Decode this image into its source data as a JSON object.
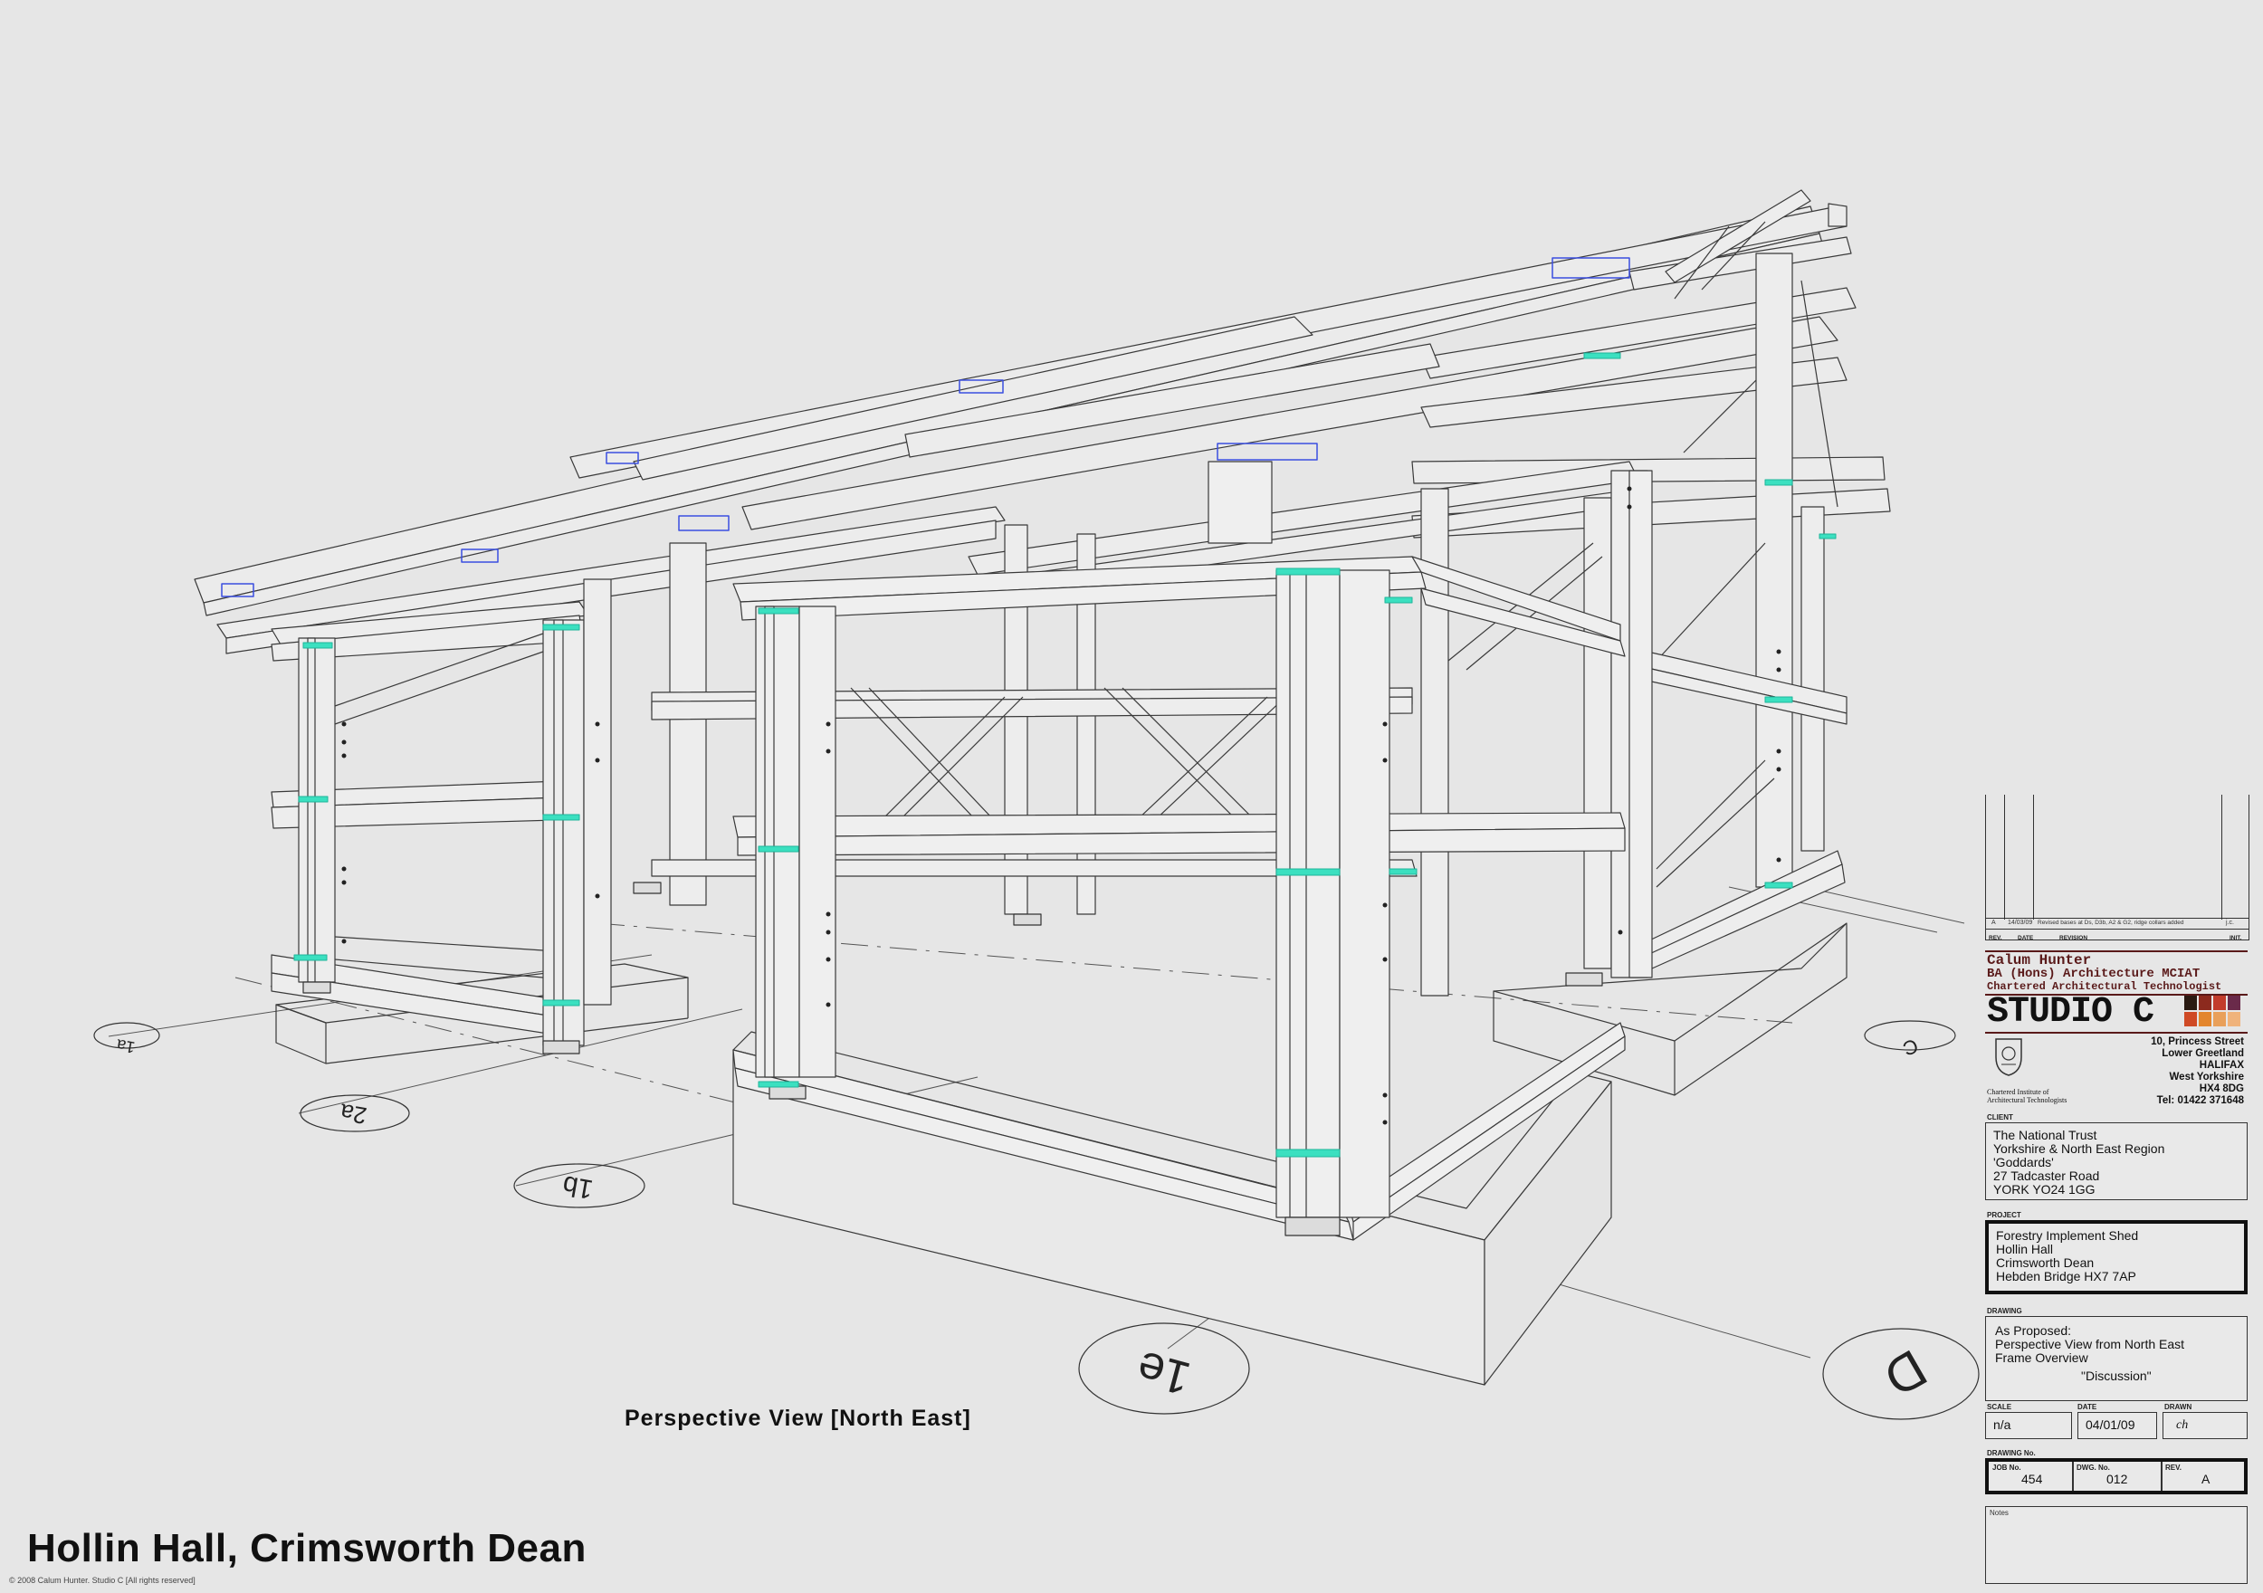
{
  "sheet": {
    "main_title": "Hollin Hall, Crimsworth Dean",
    "copyright": "©  2008 Calum Hunter.  Studio C  [All rights reserved]",
    "view_title": "Perspective View [North East]"
  },
  "grid_labels": [
    "1a",
    "2a",
    "1b",
    "1e",
    "C",
    "D"
  ],
  "revisions": {
    "row": {
      "rev": "A",
      "date": "14/03/09",
      "description": "Revised bases at Ds, D3b, A2 & G2, ridge collars added",
      "init": "j.c."
    },
    "headers": [
      "REV.",
      "DATE",
      "REVISION",
      "INIT."
    ]
  },
  "firm": {
    "name_lines": [
      "Calum Hunter",
      "BA (Hons) Architecture MCIAT",
      "Chartered Architectural Technologist"
    ],
    "studio": "STUDIO C",
    "swatch_colors": [
      "#2a1a12",
      "#8c2a1e",
      "#c23c2c",
      "#6a2a4a",
      "#cf4a25",
      "#e3862d",
      "#e9a05a",
      "#f0b37b"
    ],
    "address_lines": [
      "10, Princess Street",
      "Lower Greetland",
      "HALIFAX",
      "West Yorkshire",
      "HX4 8DG"
    ],
    "tel": "Tel:  01422 371648",
    "institute_lines": [
      "Chartered Institute of",
      "Architectural Technologists"
    ]
  },
  "client": {
    "label": "CLIENT",
    "lines": [
      "The National Trust",
      "Yorkshire & North East Region",
      "'Goddards'",
      "27 Tadcaster Road",
      "YORK YO24 1GG"
    ]
  },
  "project": {
    "label": "PROJECT",
    "lines": [
      "Forestry Implement Shed",
      "Hollin Hall",
      "Crimsworth Dean",
      "Hebden Bridge HX7 7AP"
    ]
  },
  "drawing": {
    "label": "DRAWING",
    "lines": [
      "As Proposed:",
      "Perspective View from North East",
      "Frame Overview"
    ],
    "status": "\"Discussion\""
  },
  "meta": {
    "scale_label": "SCALE",
    "scale": "n/a",
    "date_label": "DATE",
    "date": "04/01/09",
    "drawn_label": "DRAWN",
    "drawn": "ch"
  },
  "drawing_no": {
    "label": "DRAWING No.",
    "job_label": "JOB No.",
    "job": "454",
    "dwg_label": "DWG. No.",
    "dwg": "012",
    "rev_label": "REV.",
    "rev": "A"
  },
  "notes": {
    "label": "Notes"
  },
  "colors": {
    "paper": "#e6e6e6",
    "line": "#3a3a3a",
    "cyan": "#3be0c0",
    "blue": "#3a4ee0",
    "brand": "#5a1a1a"
  }
}
